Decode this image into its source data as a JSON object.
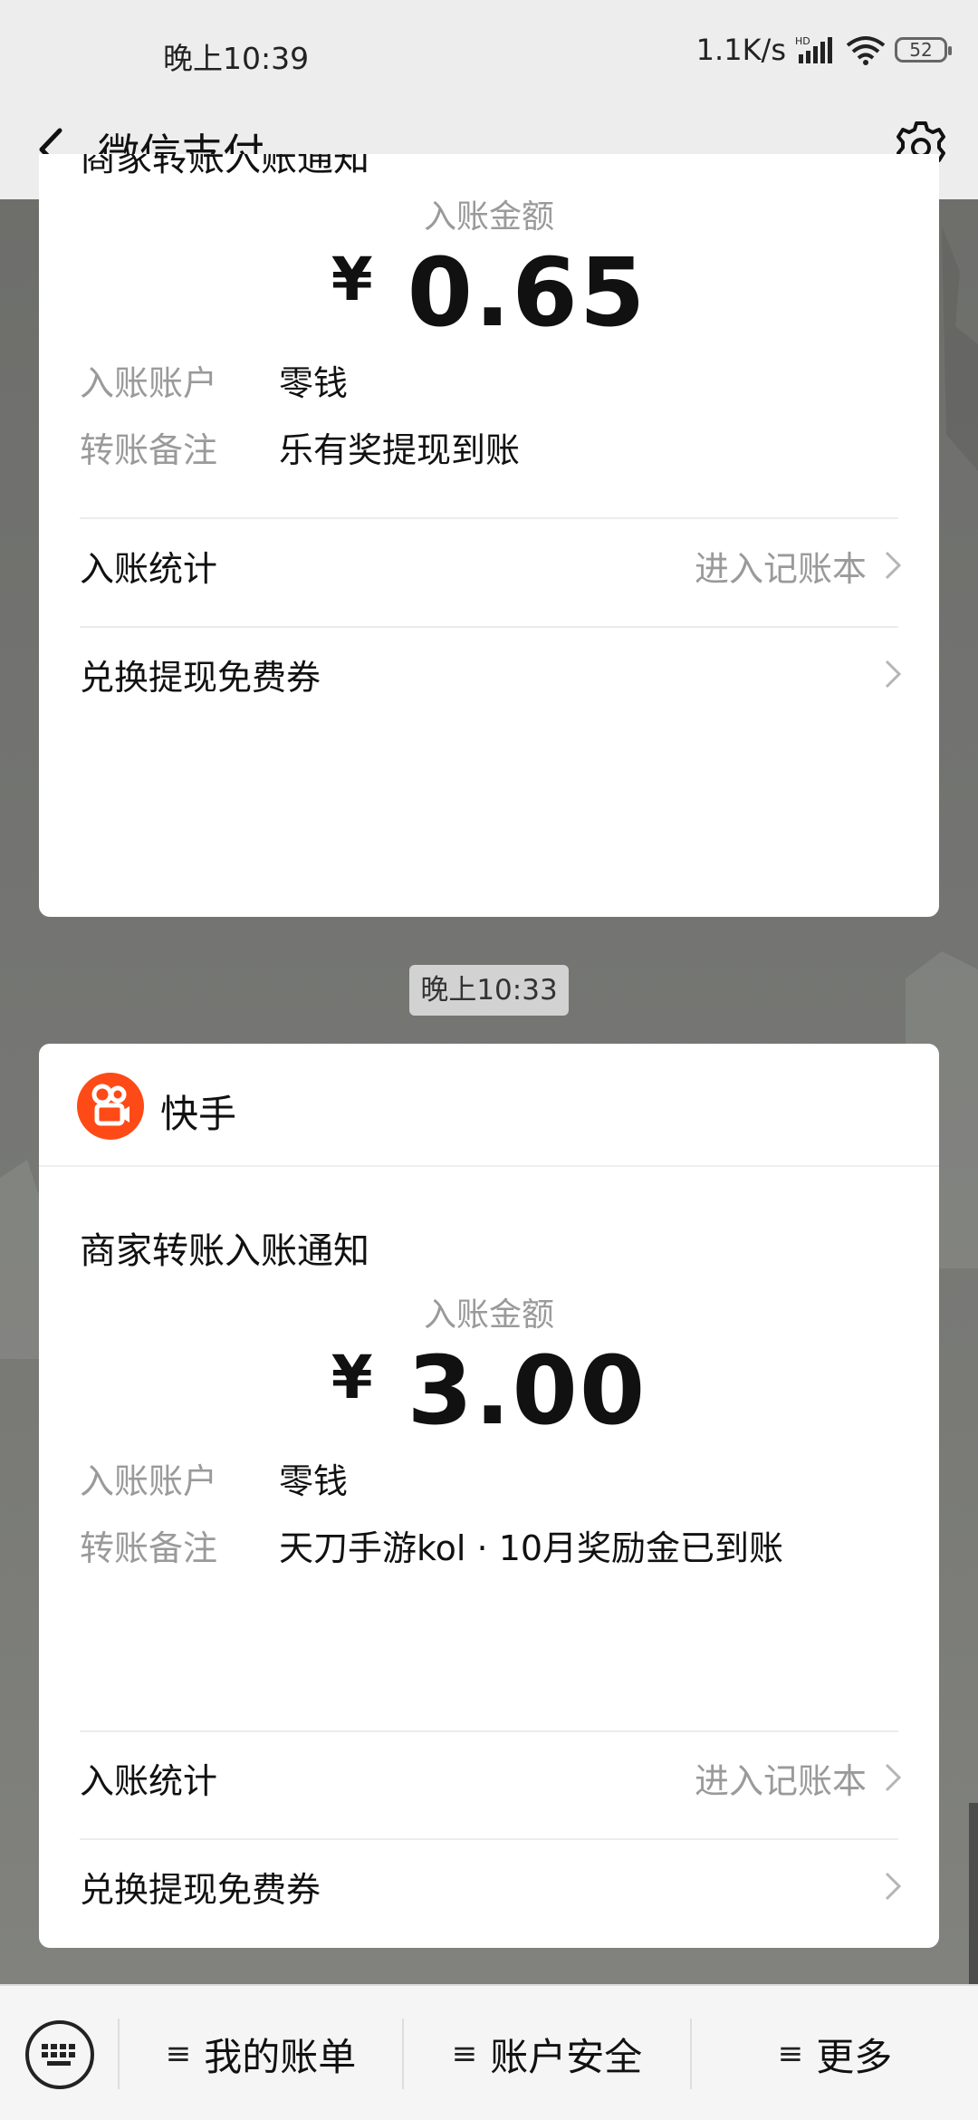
{
  "status_bar": {
    "time": "晚上10:39",
    "speed": "1.1K/s",
    "battery": "52"
  },
  "nav": {
    "title": "微信支付"
  },
  "card1": {
    "title": "商家转账入账通知",
    "amount_label": "入账金额",
    "currency": "¥",
    "amount": "0.65",
    "account_label": "入账账户",
    "account_value": "零钱",
    "remark_label": "转账备注",
    "remark_value": "乐有奖提现到账",
    "stats_label": "入账统计",
    "stats_link": "进入记账本",
    "coupon_label": "兑换提现免费券"
  },
  "timestamp": "晚上10:33",
  "card2": {
    "merchant_name": "快手",
    "title": "商家转账入账通知",
    "amount_label": "入账金额",
    "currency": "¥",
    "amount": "3.00",
    "account_label": "入账账户",
    "account_value": "零钱",
    "remark_label": "转账备注",
    "remark_value": "天刀手游kol · 10月奖励金已到账",
    "stats_label": "入账统计",
    "stats_link": "进入记账本",
    "coupon_label": "兑换提现免费券"
  },
  "bottom_bar": {
    "menu_icon": "≡",
    "bills": "我的账单",
    "security": "账户安全",
    "more": "更多"
  },
  "colors": {
    "kuaishou_orange": "#fe4a16",
    "nav_bg": "#ededed",
    "chat_bg": "#737471"
  }
}
